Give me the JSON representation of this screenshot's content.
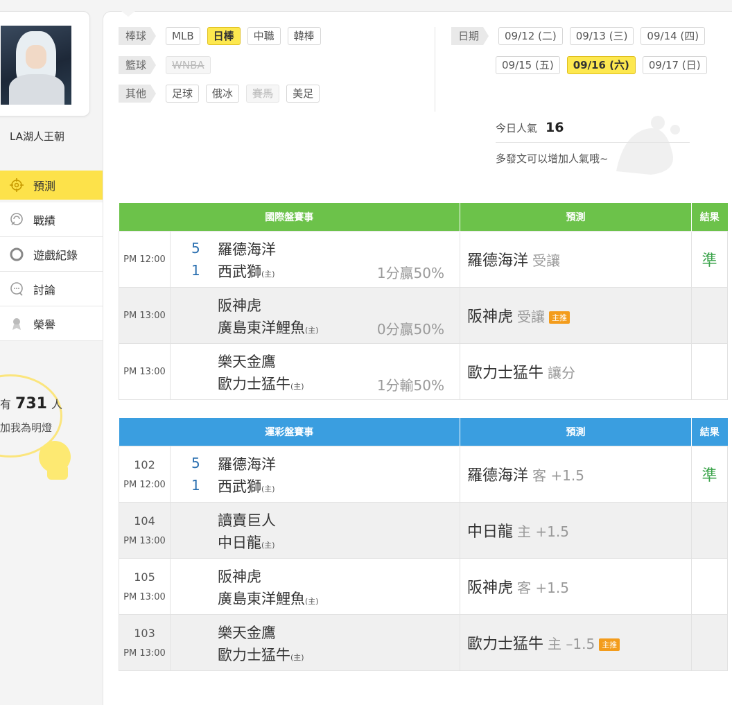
{
  "profile": {
    "username": "LA湖人王朝",
    "fans_prefix": "有",
    "fans_count": "731",
    "fans_suffix": "人",
    "fans_caption": "加我為明燈"
  },
  "menu": [
    {
      "label": "預測",
      "icon": "target-icon",
      "active": true
    },
    {
      "label": "戰績",
      "icon": "record-icon",
      "active": false
    },
    {
      "label": "遊戲紀錄",
      "icon": "circle-icon",
      "active": false
    },
    {
      "label": "討論",
      "icon": "chat-icon",
      "active": false
    },
    {
      "label": "榮譽",
      "icon": "medal-icon",
      "active": false
    }
  ],
  "filters": {
    "baseball": {
      "label": "棒球",
      "chips": [
        "MLB",
        "日棒",
        "中職",
        "韓棒"
      ],
      "selected": "日棒"
    },
    "basketball": {
      "label": "籃球",
      "chips": [
        "WNBA"
      ],
      "disabled": [
        "WNBA"
      ]
    },
    "other": {
      "label": "其他",
      "chips": [
        "足球",
        "俄冰",
        "賽馬",
        "美足"
      ],
      "disabled": [
        "賽馬"
      ]
    },
    "date": {
      "label": "日期",
      "row1": [
        "09/12 (二)",
        "09/13 (三)",
        "09/14 (四)"
      ],
      "row2": [
        "09/15 (五)",
        "09/16 (六)",
        "09/17 (日)"
      ],
      "selected": "09/16 (六)"
    }
  },
  "popularity": {
    "label": "今日人氣",
    "value": "16",
    "hint": "多發文可以增加人氣哦~"
  },
  "intl_table": {
    "headers": [
      "國際盤賽事",
      "預測",
      "結果"
    ],
    "rows": [
      {
        "time": "PM 12:00",
        "score1": "5",
        "score2": "1",
        "team1": "羅德海洋",
        "team2": "西武獅",
        "home_mark": "(主)",
        "handicap": "1分贏50%",
        "pred_team": "羅德海洋",
        "pred_note": "受讓",
        "tag": "",
        "result": "準"
      },
      {
        "time": "PM 13:00",
        "score1": "",
        "score2": "",
        "team1": "阪神虎",
        "team2": "廣島東洋鯉魚",
        "home_mark": "(主)",
        "handicap": "0分贏50%",
        "pred_team": "阪神虎",
        "pred_note": "受讓",
        "tag": "主推",
        "result": ""
      },
      {
        "time": "PM 13:00",
        "score1": "",
        "score2": "",
        "team1": "樂天金鷹",
        "team2": "歐力士猛牛",
        "home_mark": "(主)",
        "handicap": "1分輸50%",
        "pred_team": "歐力士猛牛",
        "pred_note": "讓分",
        "tag": "",
        "result": ""
      }
    ]
  },
  "lottery_table": {
    "headers": [
      "運彩盤賽事",
      "預測",
      "結果"
    ],
    "rows": [
      {
        "gid": "102",
        "time": "PM 12:00",
        "score1": "5",
        "score2": "1",
        "team1": "羅德海洋",
        "team2": "西武獅",
        "home_mark": "(主)",
        "pred_team": "羅德海洋",
        "pred_note": "客 +1.5",
        "tag": "",
        "result": "準"
      },
      {
        "gid": "104",
        "time": "PM 13:00",
        "score1": "",
        "score2": "",
        "team1": "讀賣巨人",
        "team2": "中日龍",
        "home_mark": "(主)",
        "pred_team": "中日龍",
        "pred_note": "主 +1.5",
        "tag": "",
        "result": ""
      },
      {
        "gid": "105",
        "time": "PM 13:00",
        "score1": "",
        "score2": "",
        "team1": "阪神虎",
        "team2": "廣島東洋鯉魚",
        "home_mark": "(主)",
        "pred_team": "阪神虎",
        "pred_note": "客 +1.5",
        "tag": "",
        "result": ""
      },
      {
        "gid": "103",
        "time": "PM 13:00",
        "score1": "",
        "score2": "",
        "team1": "樂天金鷹",
        "team2": "歐力士猛牛",
        "home_mark": "(主)",
        "pred_team": "歐力士猛牛",
        "pred_note": "主 –1.5",
        "tag": "主推",
        "result": ""
      }
    ]
  },
  "colors": {
    "accent_yellow": "#fde84f",
    "intl_header": "#6cc24a",
    "lottery_header": "#3a9ee0",
    "result_green": "#3aa34a",
    "tag_orange": "#f39c1c"
  }
}
